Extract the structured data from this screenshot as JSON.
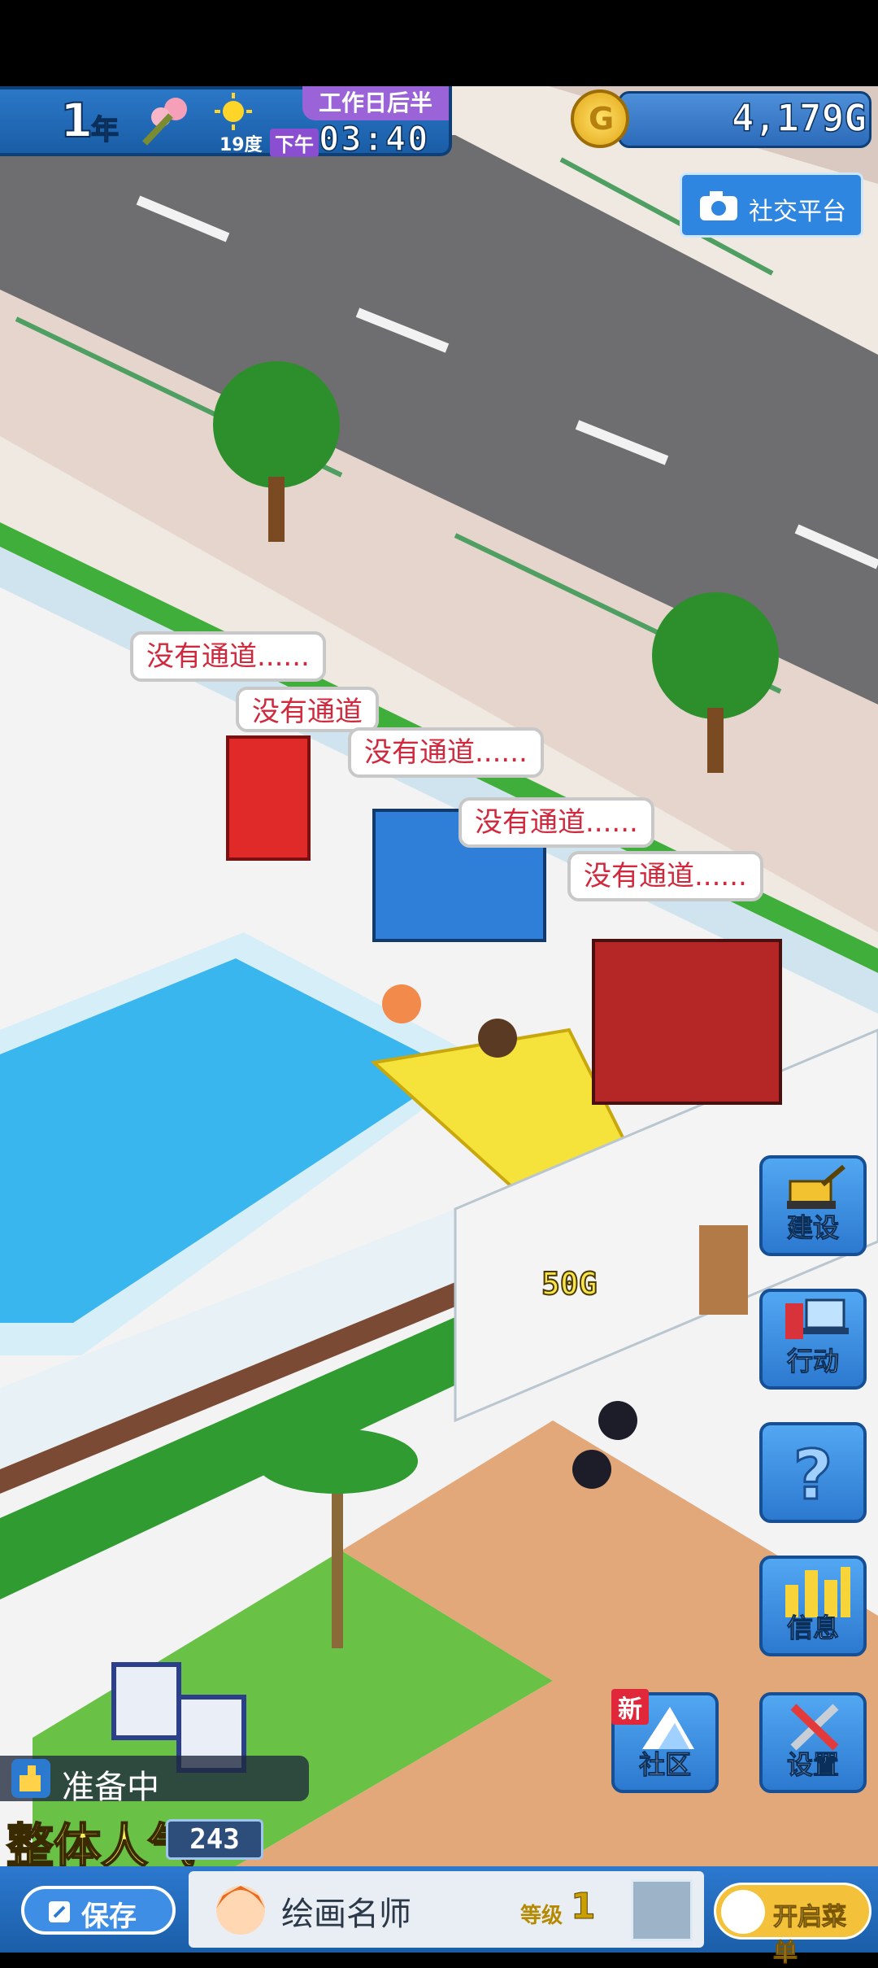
{
  "hud": {
    "year_number": "1",
    "year_label": "年",
    "temperature": "19度",
    "period": "工作日后半",
    "am_pm": "下午",
    "time": "03:40",
    "money": "4,179G"
  },
  "social_button": {
    "label": "社交平台"
  },
  "bubbles": [
    "没有通道......",
    "没有通道",
    "没有通道......",
    "没有通道......",
    "没有通道......"
  ],
  "floating_money": "50G",
  "side_menu": {
    "build": "建设",
    "action": "行动",
    "help": "?",
    "info": "信息",
    "community": "社区",
    "community_badge": "新",
    "settings": "设置"
  },
  "status": {
    "label": "准备中",
    "popularity_label": "整体人气",
    "popularity_value": "243"
  },
  "bottom_bar": {
    "save_label": "保存",
    "rank_title": "绘画名师",
    "level_label": "等级",
    "level_value": "1",
    "menu_label": "开启菜单"
  },
  "colors": {
    "ui_blue": "#2c79d0",
    "bubble_text": "#d0283c",
    "pool_water": "#39b6ee",
    "grass": "#3fae3a",
    "road": "#6e6e70"
  }
}
